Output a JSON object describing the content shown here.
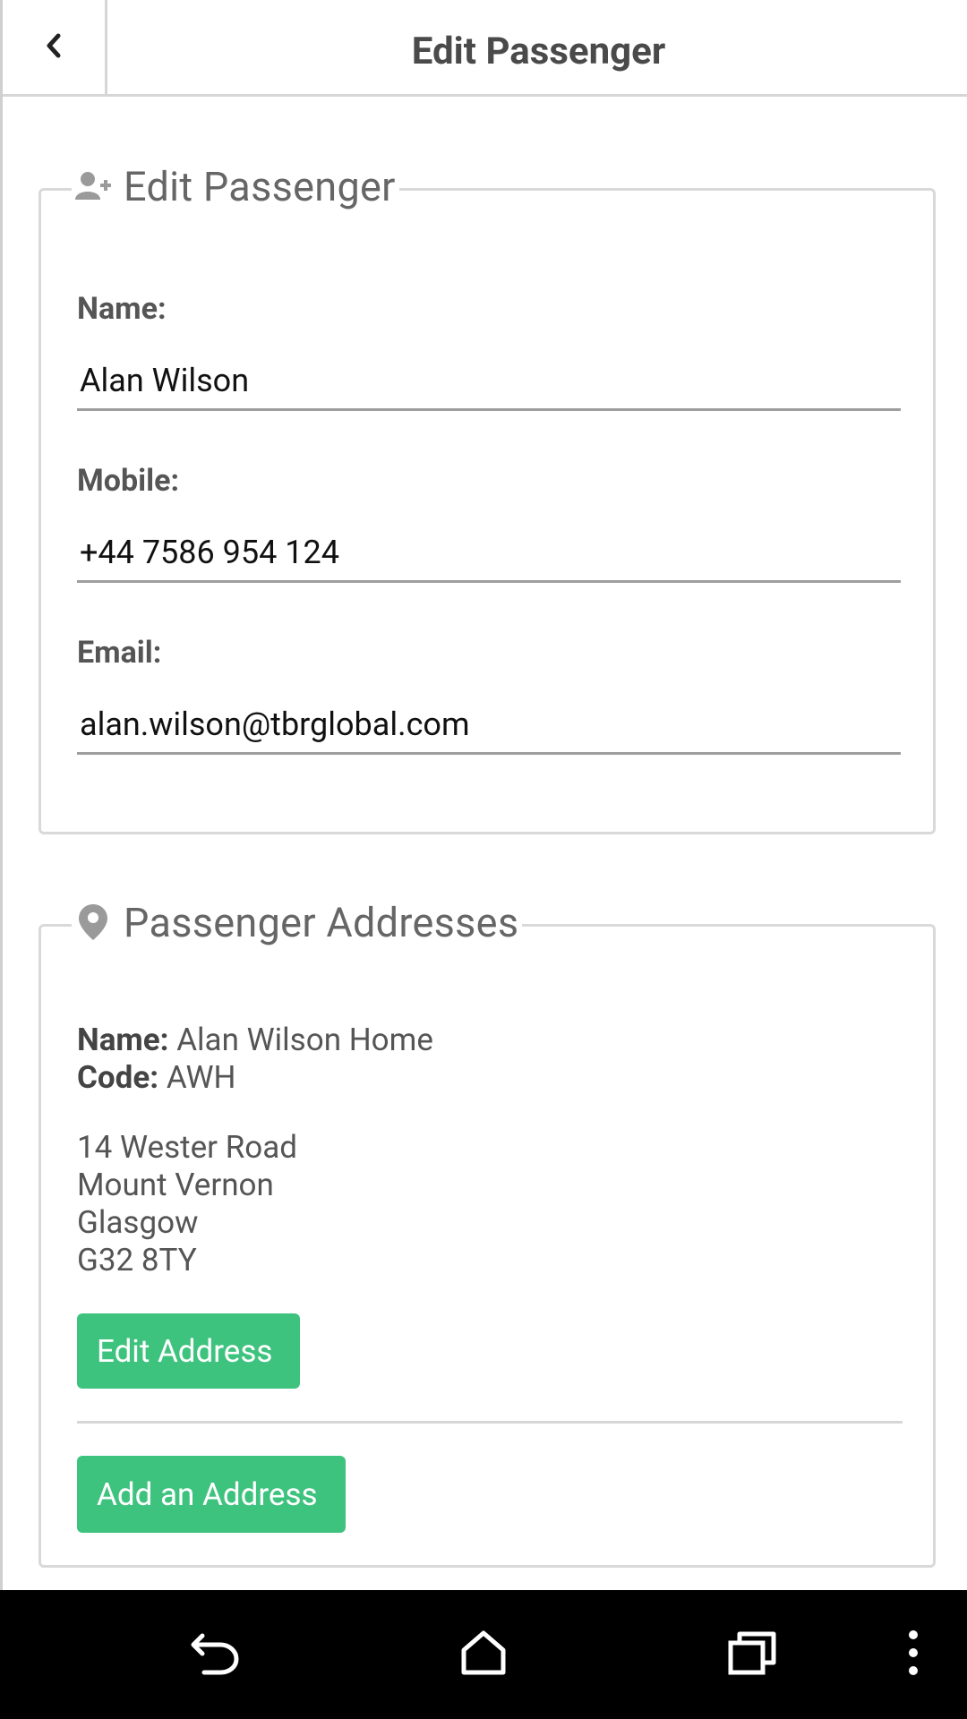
{
  "header": {
    "title": "Edit Passenger",
    "back_icon": "chevron-left-icon"
  },
  "edit_panel": {
    "legend": "Edit Passenger",
    "legend_icon": "add-user-icon",
    "fields": {
      "name": {
        "label": "Name:",
        "value": "Alan Wilson"
      },
      "mobile": {
        "label": "Mobile:",
        "value": "+44 7586 954 124"
      },
      "email": {
        "label": "Email:",
        "value": "alan.wilson@tbrglobal.com"
      }
    }
  },
  "addresses_panel": {
    "legend": "Passenger Addresses",
    "legend_icon": "map-marker-icon",
    "items": [
      {
        "name_label": "Name:",
        "name_value": "Alan Wilson Home",
        "code_label": "Code:",
        "code_value": "AWH",
        "lines": [
          "14 Wester Road",
          "Mount Vernon",
          "Glasgow",
          "G32 8TY"
        ],
        "edit_label": "Edit Address"
      }
    ],
    "add_label": "Add an Address"
  },
  "navbar": {
    "icons": [
      "back-arrow-icon",
      "home-icon",
      "recents-icon",
      "overflow-menu-icon"
    ]
  },
  "colors": {
    "accent_green": "#3ec37e",
    "label_gray": "#555555",
    "border_gray": "#d9d9d9",
    "navbar_black": "#000000"
  }
}
